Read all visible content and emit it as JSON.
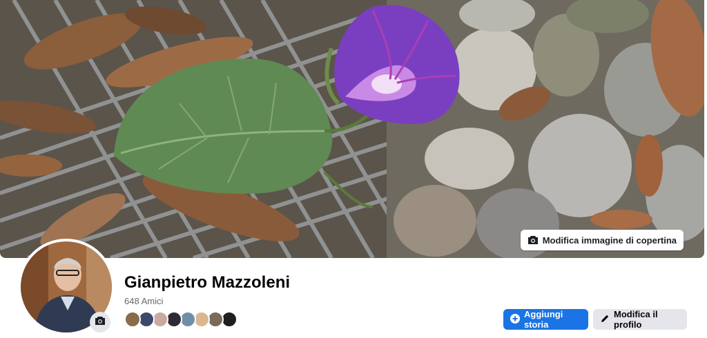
{
  "cover": {
    "edit_label": "Modifica immagine di copertina",
    "icon": "camera-icon"
  },
  "profile": {
    "name": "Gianpietro Mazzoleni",
    "friends_count": "648 Amici",
    "avatar_icon": "camera-icon"
  },
  "friend_avatars": [
    {
      "color": "#8a6b4a"
    },
    {
      "color": "#3b4a6b"
    },
    {
      "color": "#c9a9a0"
    },
    {
      "color": "#2e2a33"
    },
    {
      "color": "#6f8fa8"
    },
    {
      "color": "#d9b88f"
    },
    {
      "color": "#7a6a5c"
    },
    {
      "color": "#1f1f1f"
    }
  ],
  "actions": {
    "add_story": "Aggiungi storia",
    "edit_profile": "Modifica il profilo"
  },
  "colors": {
    "accent": "#1b74e4",
    "secondary_button": "#e4e6eb"
  }
}
